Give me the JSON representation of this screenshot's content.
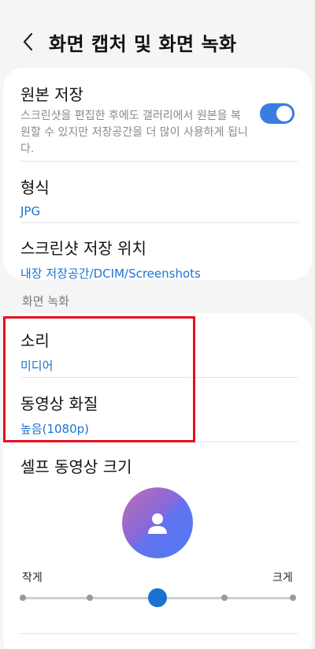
{
  "header": {
    "title": "화면 캡처 및 화면 녹화"
  },
  "screenshots": {
    "keep_original": {
      "title": "원본 저장",
      "description": "스크린샷을 편집한 후에도 갤러리에서 원본을 복원할 수 있지만 저장공간을 더 많이 사용하게 됩니다.",
      "toggle_on": true
    },
    "format": {
      "title": "형식",
      "value": "JPG"
    },
    "save_location": {
      "title": "스크린샷 저장 위치",
      "value": "내장 저장공간/DCIM/Screenshots"
    }
  },
  "screen_recording": {
    "section_title": "화면 녹화",
    "sound": {
      "title": "소리",
      "value": "미디어"
    },
    "video_quality": {
      "title": "동영상 화질",
      "value": "높음(1080p)"
    },
    "selfie_size": {
      "title": "셀프 동영상 크기",
      "min_label": "작게",
      "max_label": "크게",
      "steps": 5,
      "selected_step": 3
    }
  },
  "colors": {
    "accent": "#1a73d1",
    "highlight": "#e8101e",
    "avatar_gradient": [
      "#c06fb0",
      "#7a67e6",
      "#4f7cf5"
    ]
  },
  "icons": {
    "back": "chevron-left-icon",
    "avatar": "person-icon"
  }
}
